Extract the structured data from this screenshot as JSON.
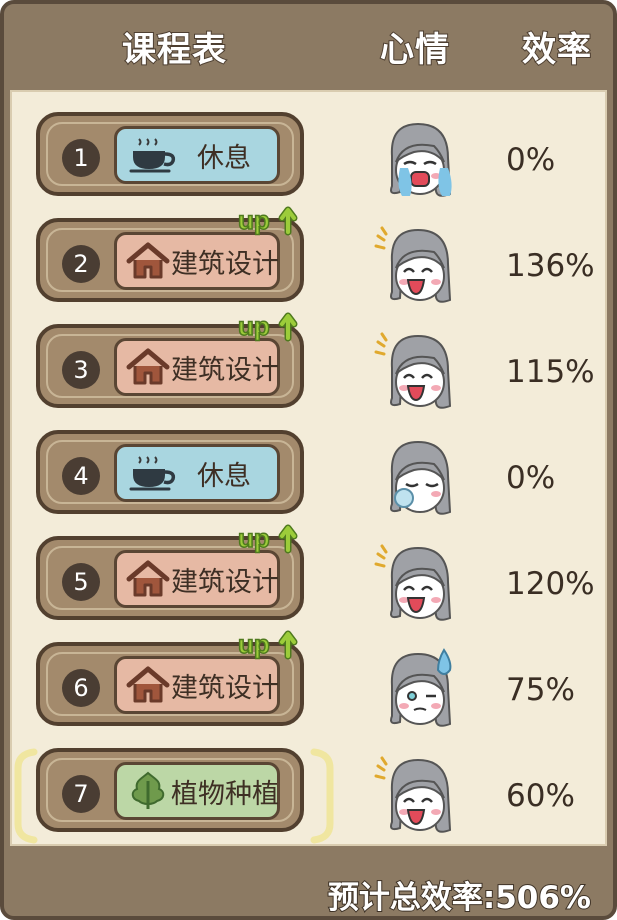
{
  "header": {
    "schedule": "课程表",
    "mood": "心情",
    "efficiency": "效率"
  },
  "rows": [
    {
      "number": "1",
      "course": "休息",
      "course_icon": "coffee-cup-icon",
      "course_type": "rest",
      "up": false,
      "mood": "crying",
      "efficiency": "0%"
    },
    {
      "number": "2",
      "course": "建筑设计",
      "course_icon": "house-icon",
      "course_type": "architecture",
      "up": true,
      "mood": "happy",
      "efficiency": "136%"
    },
    {
      "number": "3",
      "course": "建筑设计",
      "course_icon": "house-icon",
      "course_type": "architecture",
      "up": true,
      "mood": "happy",
      "efficiency": "115%"
    },
    {
      "number": "4",
      "course": "休息",
      "course_icon": "coffee-cup-icon",
      "course_type": "rest",
      "up": false,
      "mood": "sleeping",
      "efficiency": "0%"
    },
    {
      "number": "5",
      "course": "建筑设计",
      "course_icon": "house-icon",
      "course_type": "architecture",
      "up": true,
      "mood": "happy",
      "efficiency": "120%"
    },
    {
      "number": "6",
      "course": "建筑设计",
      "course_icon": "house-icon",
      "course_type": "architecture",
      "up": true,
      "mood": "nervous",
      "efficiency": "75%"
    },
    {
      "number": "7",
      "course": "植物种植",
      "course_icon": "leaf-icon",
      "course_type": "plant",
      "up": false,
      "mood": "happy",
      "efficiency": "60%",
      "selected": true
    }
  ],
  "up_label": "up",
  "footer": {
    "total": "预计总效率:506%"
  },
  "colors": {
    "frame": "#8c7a63",
    "panel": "#f3ecd9",
    "rest": "#a9d6e0",
    "architecture": "#e6b9a4",
    "plant": "#bcd7a6",
    "up": "#9ccc3a"
  }
}
